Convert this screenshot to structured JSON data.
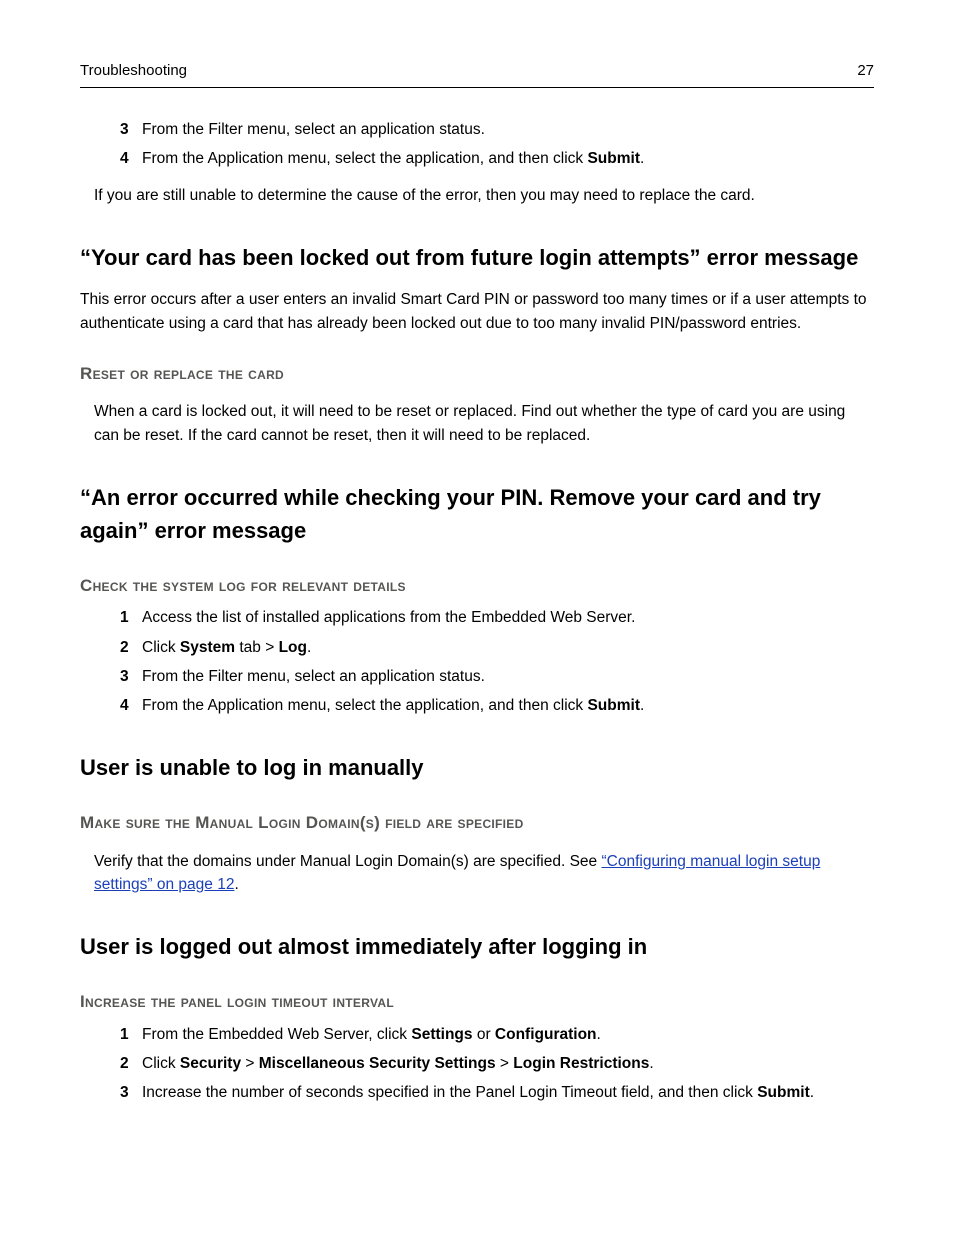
{
  "header": {
    "left": "Troubleshooting",
    "right": "27"
  },
  "ol1": {
    "i3": {
      "n": "3",
      "t": "From the Filter menu, select an application status."
    },
    "i4": {
      "n": "4",
      "pre": "From the Application menu, select the application, and then click ",
      "bold": "Submit",
      "post": "."
    }
  },
  "p_replace": "If you are still unable to determine the cause of the error, then you may need to replace the card.",
  "s1": {
    "title": "“Your card has been locked out from future login attempts” error message",
    "p": "This error occurs after a user enters an invalid Smart Card PIN or password too many times or if a user attempts to authenticate using a card that has already been locked out due to too many invalid PIN/password entries.",
    "sub": "Reset or replace the card",
    "subp": "When a card is locked out, it will need to be reset or replaced. Find out whether the type of card you are using can be reset. If the card cannot be reset, then it will need to be replaced."
  },
  "s2": {
    "title": "“An error occurred while checking your PIN. Remove your card and try again” error message",
    "sub": "Check the system log for relevant details",
    "i1": {
      "n": "1",
      "t": "Access the list of installed applications from the Embedded Web Server."
    },
    "i2": {
      "n": "2",
      "pre": "Click ",
      "b1": "System",
      "mid": " tab > ",
      "b2": "Log",
      "post": "."
    },
    "i3": {
      "n": "3",
      "t": "From the Filter menu, select an application status."
    },
    "i4": {
      "n": "4",
      "pre": "From the Application menu, select the application, and then click ",
      "bold": "Submit",
      "post": "."
    }
  },
  "s3": {
    "title": "User is unable to log in manually",
    "sub": "Make sure the Manual Login Domain(s) field are specified",
    "p_pre": "Verify that the domains under Manual Login Domain(s) are specified. See ",
    "link": "“Configuring manual login setup settings” on page 12",
    "p_post": "."
  },
  "s4": {
    "title": "User is logged out almost immediately after logging in",
    "sub": "Increase the panel login timeout interval",
    "i1": {
      "n": "1",
      "pre": "From the Embedded Web Server, click ",
      "b1": "Settings",
      "mid": " or ",
      "b2": "Configuration",
      "post": "."
    },
    "i2": {
      "n": "2",
      "pre": "Click ",
      "b1": "Security",
      "s1": " > ",
      "b2": "Miscellaneous Security Settings",
      "s2": " > ",
      "b3": "Login Restrictions",
      "post": "."
    },
    "i3": {
      "n": "3",
      "pre": "Increase the number of seconds specified in the Panel Login Timeout field, and then click ",
      "bold": "Submit",
      "post": "."
    }
  }
}
